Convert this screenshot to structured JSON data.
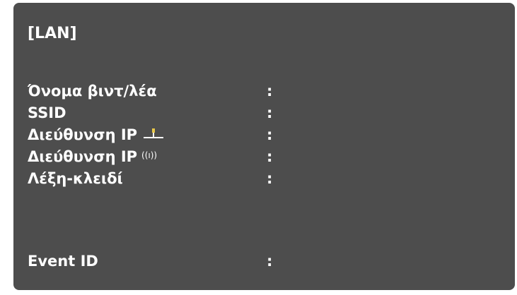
{
  "panel": {
    "title": "[LAN]",
    "rows": [
      {
        "label": "Όνομα βιντ/λέα",
        "separator": ":"
      },
      {
        "label": "SSID",
        "separator": ":"
      },
      {
        "label": "Διεύθυνση IP",
        "icon": "wired-lan-icon",
        "separator": ":"
      },
      {
        "label": "Διεύθυνση IP",
        "icon": "wireless-icon",
        "icon_glyph": "((ı))",
        "separator": ":"
      },
      {
        "label": "Λέξη-κλειδί",
        "separator": ":"
      },
      {
        "label": "Event ID",
        "separator": ":"
      }
    ]
  },
  "colors": {
    "background": "#4d4d4d",
    "text": "#ffffff",
    "wired_icon_accent": "#e8c84a"
  }
}
